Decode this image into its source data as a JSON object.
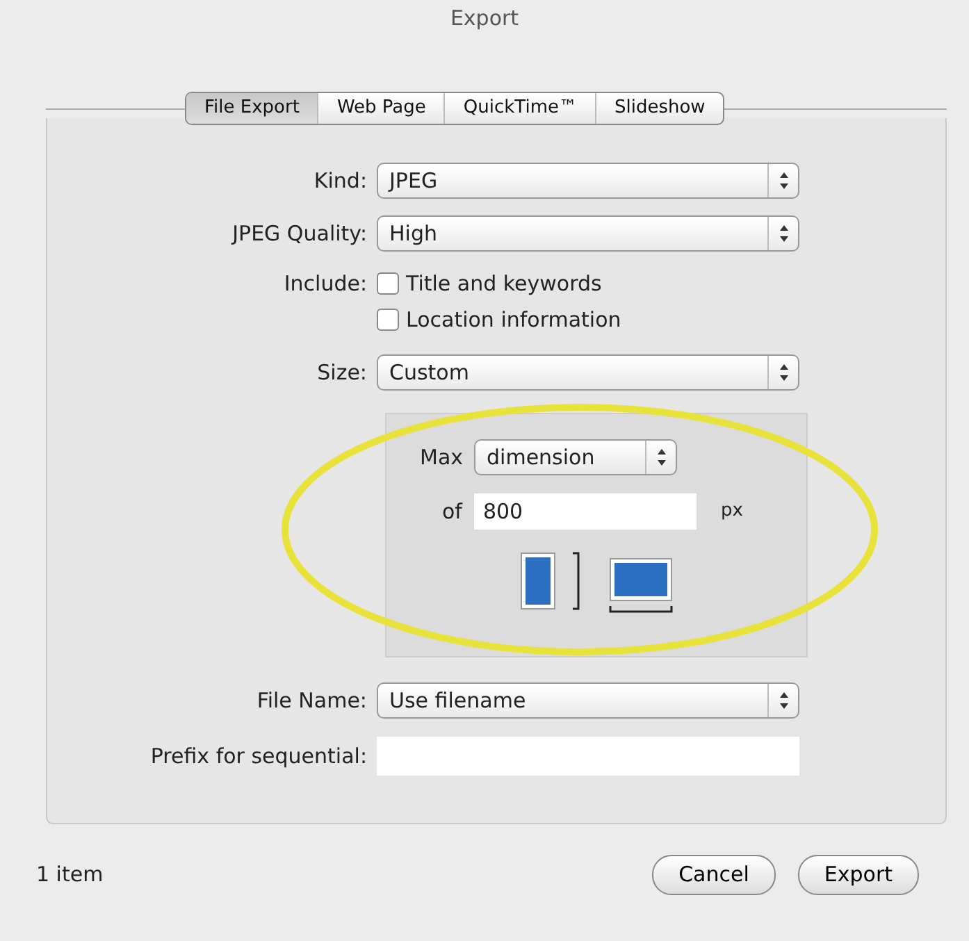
{
  "window": {
    "title": "Export"
  },
  "tabs": [
    {
      "label": "File Export",
      "selected": true
    },
    {
      "label": "Web Page",
      "selected": false
    },
    {
      "label": "QuickTime™",
      "selected": false
    },
    {
      "label": "Slideshow",
      "selected": false
    }
  ],
  "kind": {
    "label": "Kind:",
    "value": "JPEG"
  },
  "quality": {
    "label": "JPEG Quality:",
    "value": "High"
  },
  "include": {
    "label": "Include:",
    "options": [
      {
        "label": "Title and keywords",
        "checked": false
      },
      {
        "label": "Location information",
        "checked": false
      }
    ]
  },
  "size": {
    "label": "Size:",
    "value": "Custom",
    "max_label": "Max",
    "max_value": "dimension",
    "of_label": "of",
    "of_value": "800",
    "unit": "px"
  },
  "file_name": {
    "label": "File Name:",
    "value": "Use filename"
  },
  "prefix": {
    "label": "Prefix for sequential:"
  },
  "status": "1 item",
  "buttons": [
    "Cancel",
    "Export"
  ]
}
